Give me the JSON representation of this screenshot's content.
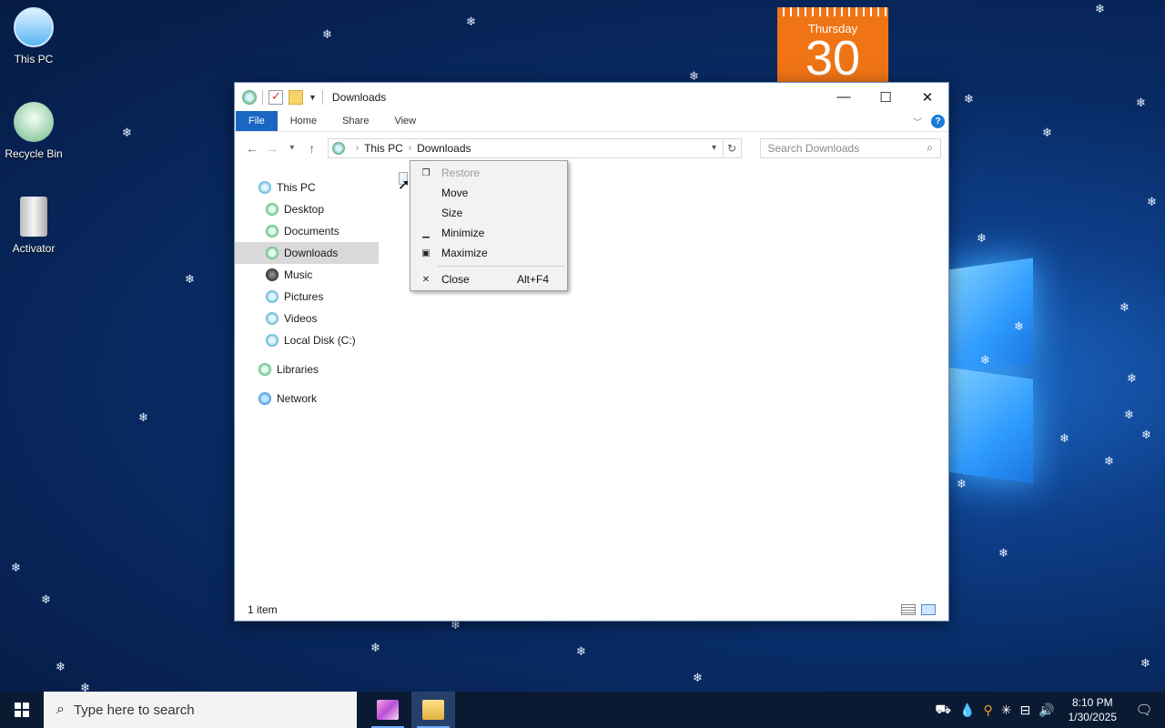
{
  "desktop": {
    "icons": [
      {
        "label": "This PC",
        "icon": "computer-icon"
      },
      {
        "label": "Recycle Bin",
        "icon": "recycle-bin-icon"
      },
      {
        "label": "Activator",
        "icon": "activator-icon"
      }
    ],
    "calendar": {
      "weekday": "Thursday",
      "day": "30"
    }
  },
  "window": {
    "title": "Downloads",
    "ribbon_tabs": {
      "file": "File",
      "home": "Home",
      "share": "Share",
      "view": "View"
    },
    "help": "?",
    "address": {
      "root": "This PC",
      "current": "Downloads"
    },
    "search_placeholder": "Search Downloads",
    "nav": {
      "this_pc": "This PC",
      "desktop": "Desktop",
      "documents": "Documents",
      "downloads": "Downloads",
      "music": "Music",
      "pictures": "Pictures",
      "videos": "Videos",
      "local_disk": "Local Disk (C:)",
      "libraries": "Libraries",
      "network": "Network"
    },
    "status": "1 item"
  },
  "context_menu": {
    "restore": "Restore",
    "move": "Move",
    "size": "Size",
    "minimize": "Minimize",
    "maximize": "Maximize",
    "close": "Close",
    "close_shortcut": "Alt+F4"
  },
  "taskbar": {
    "search_placeholder": "Type here to search",
    "time": "8:10 PM",
    "date": "1/30/2025"
  }
}
